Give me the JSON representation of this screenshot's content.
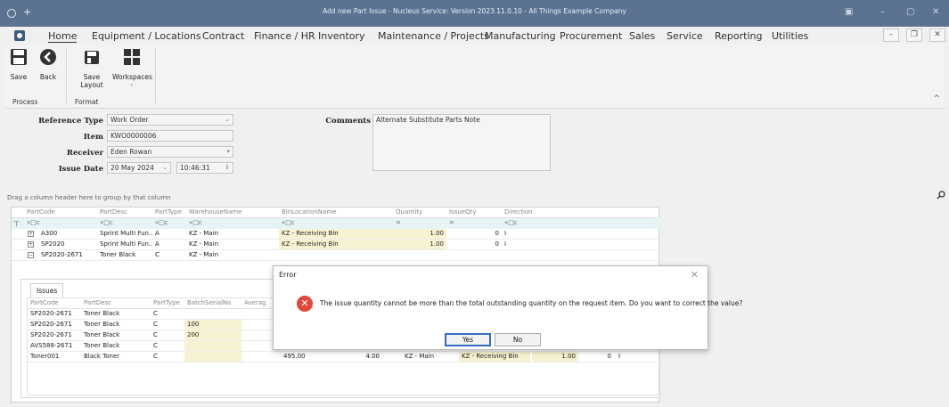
{
  "window": {
    "title": "Add new Part Issue - Nucleus Service: Version 2023.11.0.10 - All Things Example Company"
  },
  "menu": {
    "items": [
      "Home",
      "Equipment / Locations",
      "Contract",
      "Finance / HR",
      "Inventory",
      "Maintenance / Projects",
      "Manufacturing",
      "Procurement",
      "Sales",
      "Service",
      "Reporting",
      "Utilities"
    ]
  },
  "ribbon": {
    "save": "Save",
    "back": "Back",
    "save_layout": "Save Layout",
    "workspaces": "Workspaces",
    "group_process": "Process",
    "group_format": "Format"
  },
  "form": {
    "reference_type_label": "Reference Type",
    "reference_type_value": "Work Order",
    "item_label": "Item",
    "item_value": "KWO0000006",
    "receiver_label": "Receiver",
    "receiver_value": "Eden Rowan",
    "issue_date_label": "Issue Date",
    "issue_date_value": "20 May 2024",
    "issue_time_value": "10:46:31",
    "comments_label": "Comments",
    "comments_value": "Alternate Substitute Parts Note"
  },
  "grid": {
    "group_hint": "Drag a column header here to group by that column",
    "columns": [
      "PartCode",
      "PartDesc",
      "PartType",
      "WarehouseName",
      "BinLocationName",
      "Quantity",
      "IssueQty",
      "Direction"
    ],
    "rows": [
      {
        "code": "A300",
        "desc": "Sprint Multi Fun...",
        "type": "A",
        "warehouse": "KZ - Main",
        "bin": "KZ - Receiving Bin",
        "qty": "1.00",
        "issue": "0",
        "dir": "I",
        "exp": "+"
      },
      {
        "code": "SP2020",
        "desc": "Sprint Multi Fun...",
        "type": "A",
        "warehouse": "KZ - Main",
        "bin": "KZ - Receiving Bin",
        "qty": "1.00",
        "issue": "0",
        "dir": "I",
        "exp": "+"
      },
      {
        "code": "SP2020-2671",
        "desc": "Toner Black",
        "type": "C",
        "warehouse": "KZ - Main",
        "bin": "",
        "qty": "",
        "issue": "",
        "dir": "",
        "exp": "−"
      }
    ]
  },
  "detail": {
    "tab": "Issues",
    "columns": [
      "PartCode",
      "PartDesc",
      "PartType",
      "BatchSerialNo",
      "Averag"
    ],
    "rows": [
      {
        "code": "SP2020-2671",
        "desc": "Toner Black",
        "type": "C",
        "batch": ""
      },
      {
        "code": "SP2020-2671",
        "desc": "Toner Black",
        "type": "C",
        "batch": "100"
      },
      {
        "code": "SP2020-2671",
        "desc": "Toner Black",
        "type": "C",
        "batch": "200"
      },
      {
        "code": "AVS588-2671",
        "desc": "Toner Black",
        "type": "C",
        "batch": ""
      },
      {
        "code": "Toner001",
        "desc": "Black Toner",
        "type": "C",
        "batch": "",
        "avg": "495.00",
        "val": "4.00",
        "warehouse": "KZ - Main",
        "bin": "KZ - Receiving Bin",
        "qty": "1.00",
        "issue": "0",
        "dir": "I"
      }
    ]
  },
  "dialog": {
    "title": "Error",
    "message": "The issue quantity cannot be more than the total outstanding quantity on the request item. Do you want to correct the value?",
    "yes": "Yes",
    "no": "No"
  },
  "colors": {
    "titlebar": "#5b7391",
    "error_icon": "#e0493a",
    "filter_row": "#e6f4f6",
    "editable_cell": "#f7f3d2"
  }
}
